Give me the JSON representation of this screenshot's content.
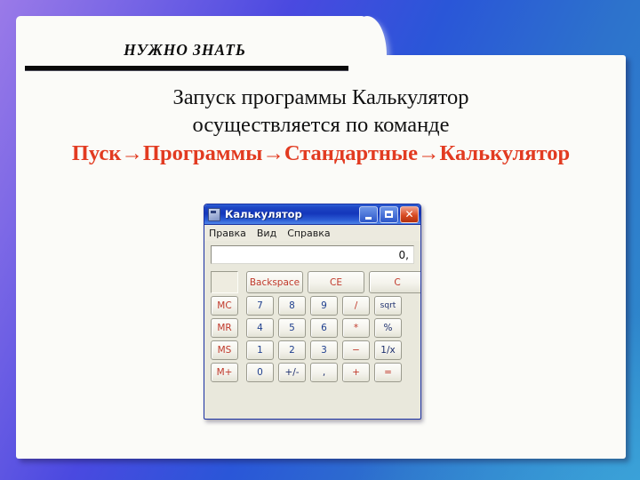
{
  "slide": {
    "kicker": "НУЖНО ЗНАТЬ",
    "body_line_1": "Запуск программы Калькулятор",
    "body_line_2": "осуществляется по команде",
    "command_path": "Пуск→Программы→Стандартные→Калькулятор",
    "command_color": "#e23b21",
    "body_color": "#121212"
  },
  "calculator": {
    "title": "Калькулятор",
    "window_buttons": {
      "minimize": "_",
      "maximize": "□",
      "close": "✕"
    },
    "menu": [
      "Правка",
      "Вид",
      "Справка"
    ],
    "display_value": "0,",
    "memory_indicator": "",
    "rows": [
      {
        "name": "edit-row",
        "buttons": [
          {
            "label": "Backspace",
            "style": "red",
            "size": "wide"
          },
          {
            "label": "CE",
            "style": "red",
            "size": "wide"
          },
          {
            "label": "C",
            "style": "red",
            "size": "wide"
          }
        ]
      },
      {
        "name": "row-7-8-9",
        "memory": {
          "label": "MC",
          "style": "red"
        },
        "buttons": [
          {
            "label": "7",
            "style": "blue"
          },
          {
            "label": "8",
            "style": "blue"
          },
          {
            "label": "9",
            "style": "blue"
          },
          {
            "label": "/",
            "style": "red"
          },
          {
            "label": "sqrt",
            "style": "navy",
            "small": true
          }
        ]
      },
      {
        "name": "row-4-5-6",
        "memory": {
          "label": "MR",
          "style": "red"
        },
        "buttons": [
          {
            "label": "4",
            "style": "blue"
          },
          {
            "label": "5",
            "style": "blue"
          },
          {
            "label": "6",
            "style": "blue"
          },
          {
            "label": "*",
            "style": "red"
          },
          {
            "label": "%",
            "style": "navy"
          }
        ]
      },
      {
        "name": "row-1-2-3",
        "memory": {
          "label": "MS",
          "style": "red"
        },
        "buttons": [
          {
            "label": "1",
            "style": "blue"
          },
          {
            "label": "2",
            "style": "blue"
          },
          {
            "label": "3",
            "style": "blue"
          },
          {
            "label": "−",
            "style": "red"
          },
          {
            "label": "1/x",
            "style": "navy"
          }
        ]
      },
      {
        "name": "row-0-sign",
        "memory": {
          "label": "M+",
          "style": "red"
        },
        "buttons": [
          {
            "label": "0",
            "style": "blue"
          },
          {
            "label": "+/-",
            "style": "navy"
          },
          {
            "label": ",",
            "style": "navy"
          },
          {
            "label": "+",
            "style": "red"
          },
          {
            "label": "=",
            "style": "red"
          }
        ]
      }
    ]
  }
}
